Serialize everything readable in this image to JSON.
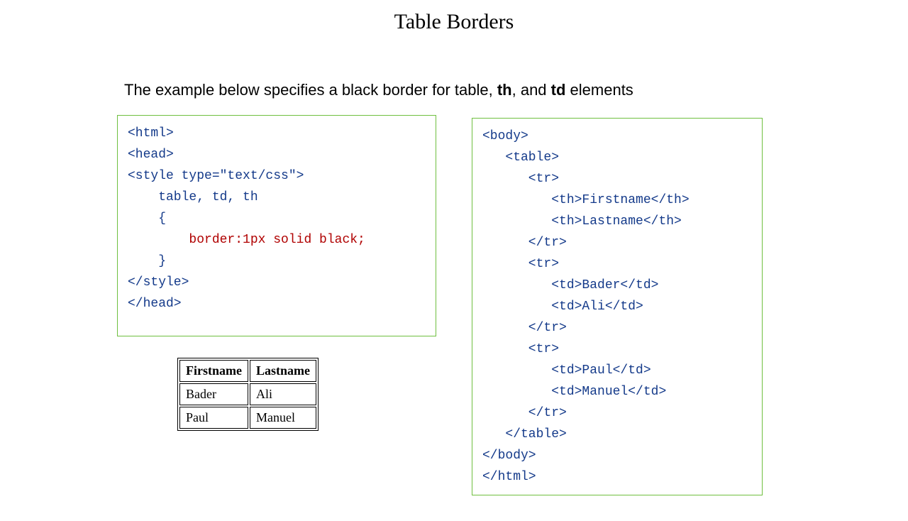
{
  "title": "Table Borders",
  "description": {
    "prefix": "The example below specifies a black border for table, ",
    "th": "th",
    "mid": ", and ",
    "td": "td",
    "suffix": " elements"
  },
  "code_left": {
    "l1": "<html>",
    "l2": "<head>",
    "l3": "<style type=\"text/css\">",
    "l4": "    table, td, th",
    "l5": "    {",
    "l6_indent": "        ",
    "l6_red": "border:1px solid black;",
    "l7": "    }",
    "l8": "</style>",
    "l9": "</head>"
  },
  "code_right": {
    "l1": "<body>",
    "l2": "   <table>",
    "l3": "      <tr>",
    "l4": "         <th>Firstname</th>",
    "l5": "         <th>Lastname</th>",
    "l6": "      </tr>",
    "l7": "      <tr>",
    "l8": "         <td>Bader</td>",
    "l9": "         <td>Ali</td>",
    "l10": "      </tr>",
    "l11": "      <tr>",
    "l12": "         <td>Paul</td>",
    "l13": "         <td>Manuel</td>",
    "l14": "      </tr>",
    "l15": "   </table>",
    "l16": "</body>",
    "l17": "</html>"
  },
  "table": {
    "headers": {
      "col1": "Firstname",
      "col2": "Lastname"
    },
    "rows": [
      {
        "col1": "Bader",
        "col2": "Ali"
      },
      {
        "col1": "Paul",
        "col2": "Manuel"
      }
    ]
  }
}
